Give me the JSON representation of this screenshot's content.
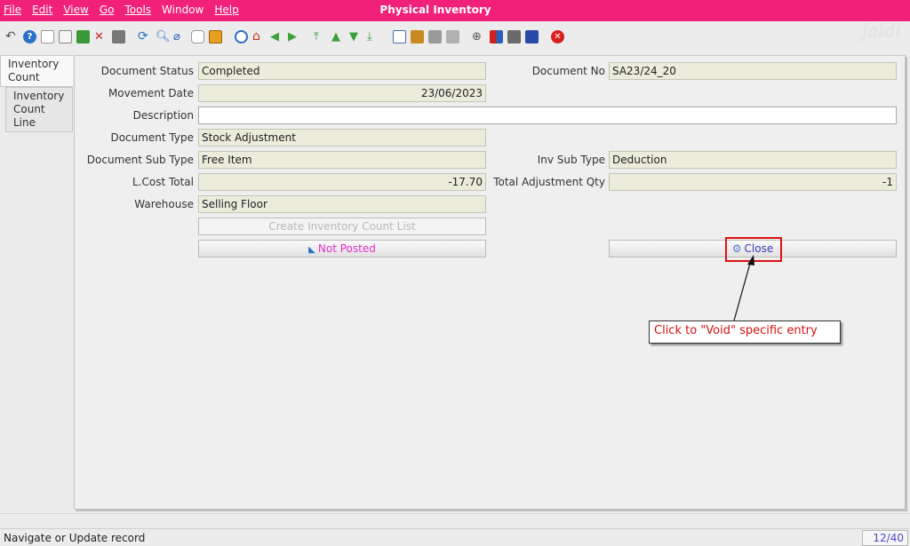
{
  "window": {
    "title": "Physical Inventory"
  },
  "menu": [
    "File",
    "Edit",
    "View",
    "Go",
    "Tools",
    "Window",
    "Help"
  ],
  "logo": "jaldi",
  "toolbar_icons": [
    "undo-icon",
    "help-icon",
    "new-icon",
    "copy-icon",
    "save-icon",
    "delete-icon",
    "save-disk-icon",
    "refresh-icon",
    "find-icon",
    "attachment-icon",
    "chat-icon",
    "grid-toggle-icon",
    "history-icon",
    "home-icon",
    "back-icon",
    "forward-icon",
    "first-record-icon",
    "previous-record-icon",
    "next-record-icon",
    "last-record-icon",
    "report-icon",
    "archive-icon",
    "print-preview-icon",
    "print-icon",
    "zoom-across-icon",
    "workflow-icon",
    "active-workflow-icon",
    "product-info-icon",
    "exit-icon"
  ],
  "tabs": [
    {
      "label": "Inventory Count",
      "active": true
    },
    {
      "label": "Inventory Count Line",
      "active": false
    }
  ],
  "form": {
    "document_status": {
      "label": "Document Status",
      "value": "Completed"
    },
    "document_no": {
      "label": "Document No",
      "value": "SA23/24_20"
    },
    "movement_date": {
      "label": "Movement Date",
      "value": "23/06/2023"
    },
    "description": {
      "label": "Description",
      "value": ""
    },
    "document_type": {
      "label": "Document Type",
      "value": "Stock Adjustment"
    },
    "document_sub_type": {
      "label": "Document Sub Type",
      "value": "Free Item"
    },
    "inv_sub_type": {
      "label": "Inv Sub Type",
      "value": "Deduction"
    },
    "lcost_total": {
      "label": "L.Cost Total",
      "value": "-17.70"
    },
    "total_adjustment_qty": {
      "label": "Total Adjustment Qty",
      "value": "-1"
    },
    "warehouse": {
      "label": "Warehouse",
      "value": "Selling Floor"
    },
    "create_list_button": "Create Inventory Count List",
    "posted_button": "Not Posted",
    "close_button": "Close"
  },
  "annotation": {
    "text": "Click to \"Void\" specific entry"
  },
  "status": {
    "message": "Navigate or Update record",
    "record_count": "12/40"
  },
  "colors": {
    "menubar": "#f1217a",
    "field_readonly": "#ececdc",
    "highlight": "#e01010",
    "not_posted": "#e030c8",
    "close_text": "#3a3ab8"
  }
}
